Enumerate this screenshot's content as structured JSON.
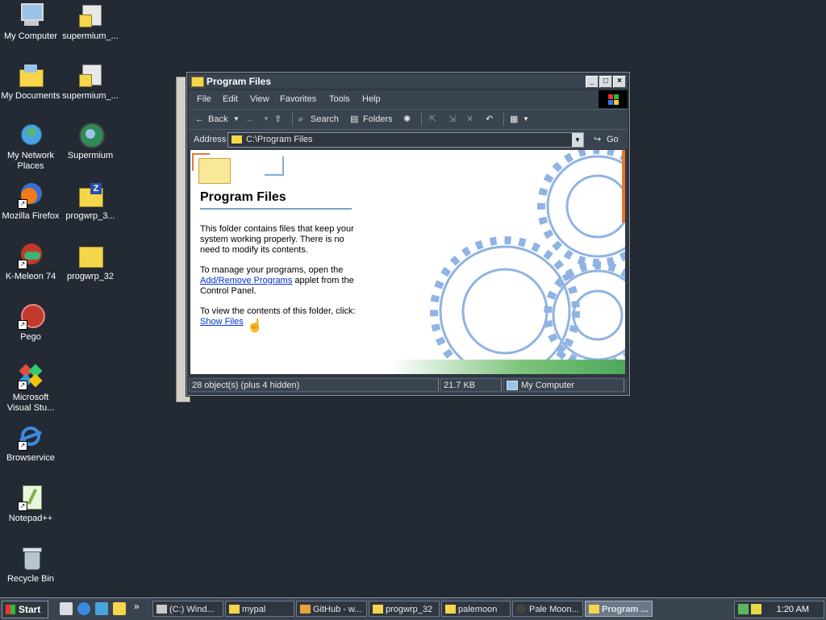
{
  "desktop": {
    "icons": [
      {
        "label": "My Computer"
      },
      {
        "label": "supermium_..."
      },
      {
        "label": "My Documents"
      },
      {
        "label": "supermium_..."
      },
      {
        "label": "My Network Places"
      },
      {
        "label": "Supermium"
      },
      {
        "label": "Mozilla Firefox"
      },
      {
        "label": "progwrp_3..."
      },
      {
        "label": "K-Meleon 74"
      },
      {
        "label": "progwrp_32"
      },
      {
        "label": "Pego"
      },
      {
        "label": "Microsoft Visual Stu..."
      },
      {
        "label": "Browservice"
      },
      {
        "label": "Notepad++"
      },
      {
        "label": "Recycle Bin"
      }
    ]
  },
  "window": {
    "title": "Program Files",
    "controls": {
      "minimize": "_",
      "maximize": "□",
      "close": "×"
    },
    "menu": [
      "File",
      "Edit",
      "View",
      "Favorites",
      "Tools",
      "Help"
    ],
    "toolbar": {
      "back": "Back",
      "search": "Search",
      "folders": "Folders"
    },
    "address": {
      "label": "Address",
      "value": "C:\\Program Files",
      "go": "Go"
    },
    "content": {
      "heading": "Program Files",
      "para1": "This folder contains files that keep your system working properly. There is no need to modify its contents.",
      "para2_pre": "To manage your programs, open the ",
      "para2_link": "Add/Remove Programs",
      "para2_post": " applet from the Control Panel.",
      "para3_pre": "To view the contents of this folder, click: ",
      "para3_link": "Show Files"
    },
    "status": {
      "objects": "28 object(s) (plus 4 hidden)",
      "size": "21.7 KB",
      "zone": "My Computer"
    }
  },
  "taskbar": {
    "start": "Start",
    "tasks": [
      {
        "label": "(C:) Wind..."
      },
      {
        "label": "mypal"
      },
      {
        "label": "GitHub - w..."
      },
      {
        "label": "progwrp_32"
      },
      {
        "label": "palemoon"
      },
      {
        "label": "Pale Moon..."
      },
      {
        "label": "Program ..."
      }
    ],
    "clock": "1:20 AM",
    "more": "»"
  },
  "colors": {
    "desktop": "#232a34",
    "link": "#0033cc",
    "folder": "#f5d54a"
  }
}
